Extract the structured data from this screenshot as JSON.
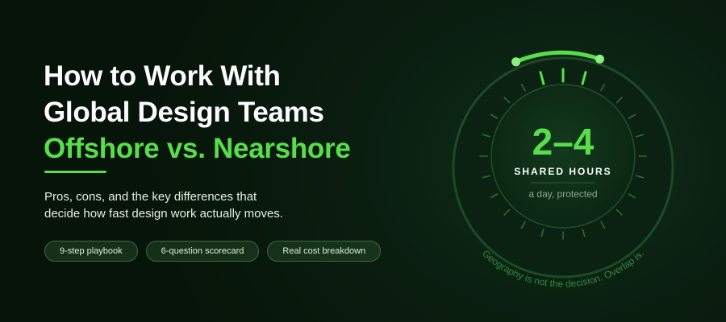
{
  "hero": {
    "title_line1": "How to Work With",
    "title_line2": "Global Design Teams",
    "title_accent": "Offshore vs. Nearshore",
    "subtitle_line1": "Pros, cons, and the key differences that",
    "subtitle_line2": "decide how fast design work actually moves."
  },
  "tags": [
    {
      "label": "9-step playbook"
    },
    {
      "label": "6-question scorecard"
    },
    {
      "label": "Real cost breakdown"
    }
  ],
  "dial": {
    "value": "2–4",
    "label": "SHARED HOURS",
    "caption": "a day, protected",
    "arc_caption": "Geography is not the decision. Overlap is."
  },
  "colors": {
    "accent": "#59de4b",
    "background": "#081a0d"
  }
}
